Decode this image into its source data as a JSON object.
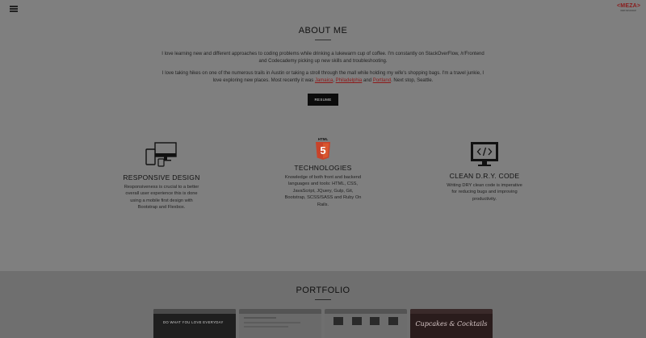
{
  "nav": {
    "menu_icon": "hamburger-icon"
  },
  "logo": {
    "text": "<MEZA>",
    "tagline": "WEB DESIGNER"
  },
  "about": {
    "title": "ABOUT ME",
    "para1": "I love learning new and different approaches to coding problems while drinking a lukewarm cup of coffee. I'm constantly on StackOverFlow, /r/Frontend and Codecademy picking up new skills and troubleshooting.",
    "para2_before": "I love taking hikes on one of the numerous trails in Austin or taking a stroll through the mall while holding my wife's shopping bags. I'm a travel junkie, I love exploring new places. Most recently it was ",
    "link1": "Jamaica",
    "sep1": ", ",
    "link2": "Philadelphia",
    "sep2": " and ",
    "link3": "Portland",
    "para2_after": ". Next stop, Seattle.",
    "resume_label": "RESUME"
  },
  "features": [
    {
      "icon": "devices-icon",
      "title": "RESPONSIVE DESIGN",
      "text": "Responsiveness is crucial to a better overall user experience this is done using a mobile first design with Bootstrap and Flexbox."
    },
    {
      "icon": "html5-icon",
      "badge": "HTML",
      "title": "TECHNOLOGIES",
      "text": "Knowledge of both front and backend languages and tools: HTML, CSS, JavaScript, JQuery, Gulp, Git, Bootstrap, SCSS/SASS and Ruby On Rails."
    },
    {
      "icon": "code-monitor-icon",
      "title": "CLEAN D.R.Y. CODE",
      "text": "Writing DRY clean code is imperative for reducing bugs and improving productivity."
    }
  ],
  "portfolio": {
    "title": "PORTFOLIO",
    "thumb1_text": "DO WHAT YOU LOVE EVERYDAY",
    "thumb4_text": "Cupcakes & Cocktails"
  },
  "colors": {
    "background": "#7f7f7f",
    "link": "#8e1a1a",
    "button": "#0c0c0c",
    "html5": "#c8432a"
  }
}
